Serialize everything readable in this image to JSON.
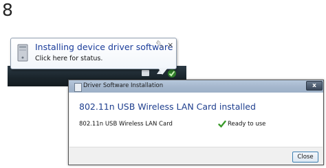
{
  "step": {
    "number": "8"
  },
  "notification": {
    "title": "Installing device driver software",
    "subtitle": "Click here for status.",
    "icons": [
      "computer-icon",
      "wrench-icon",
      "close-icon"
    ]
  },
  "taskbar": {
    "tray_icons": [
      "network-icon",
      "show-hidden-icons-icon",
      "device-install-check-icon"
    ]
  },
  "dialog": {
    "title": "Driver Software Installation",
    "close_glyph": "x",
    "heading": "802.11n USB Wireless LAN Card installed",
    "devices": [
      {
        "name": "802.11n USB Wireless LAN Card",
        "status": "Ready to use",
        "status_icon": "green-checkmark-icon"
      }
    ],
    "close_button": "Close"
  },
  "colors": {
    "link_blue": "#1a3c9a",
    "check_green": "#3a9a2a",
    "taskbar": "#1a242b"
  }
}
